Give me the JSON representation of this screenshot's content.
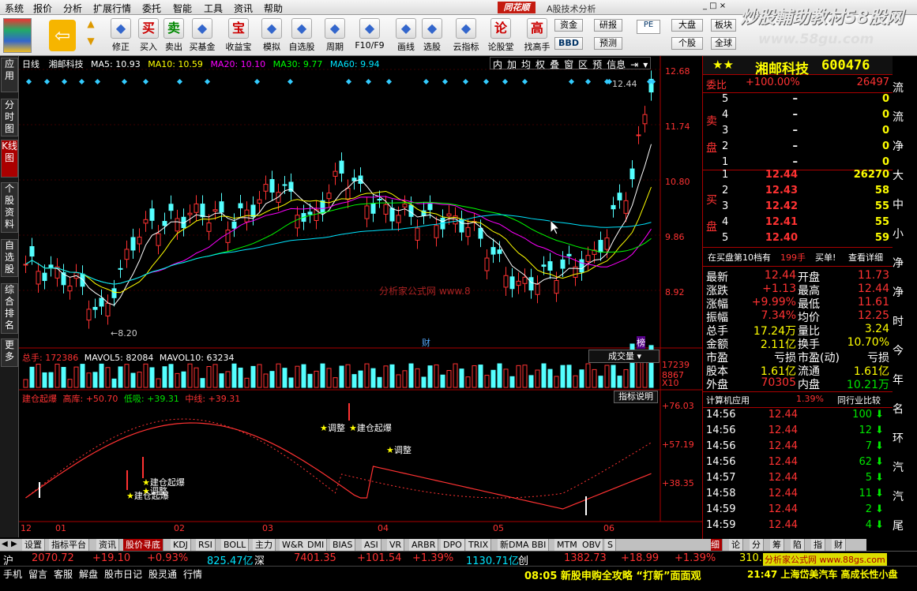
{
  "menu": [
    "系统",
    "报价",
    "分析",
    "扩展行情",
    "委托",
    "智能",
    "工具",
    "资讯",
    "帮助"
  ],
  "brand": "同花顺",
  "app_title": "A股技术分析",
  "watermark": {
    "title": "炒股輔助教材58股网",
    "url": "www.58gu.com"
  },
  "toolbar": {
    "buttons": [
      {
        "label": "修正",
        "icon": "refresh-icon"
      },
      {
        "label": "买入",
        "icon": "buy-icon",
        "glyph": "买"
      },
      {
        "label": "卖出",
        "icon": "sell-icon",
        "glyph": "卖"
      },
      {
        "label": "买基金",
        "icon": "fund-icon"
      },
      {
        "label": "收益宝",
        "icon": "bao-icon",
        "glyph": "宝"
      },
      {
        "label": "模拟",
        "icon": "hammer-icon"
      },
      {
        "label": "自选股",
        "icon": "star-icon"
      },
      {
        "label": "周期",
        "icon": "clock-icon"
      },
      {
        "label": "F10/F9",
        "icon": "f10-icon"
      },
      {
        "label": "画线",
        "icon": "pen-icon"
      },
      {
        "label": "选股",
        "icon": "picture-icon"
      },
      {
        "label": "云指标",
        "icon": "cloud-icon"
      },
      {
        "label": "论股堂",
        "icon": "lun-icon",
        "glyph": "论"
      },
      {
        "label": "找高手",
        "icon": "gao-icon",
        "glyph": "高"
      }
    ],
    "small": [
      "资金",
      "研报",
      "大盘",
      "板块",
      "BBD",
      "预测",
      "个股",
      "全球"
    ]
  },
  "sidebar": [
    "应用",
    "分时图",
    "K线图",
    "个股资料",
    "自选股",
    "综合排名",
    "更多"
  ],
  "chart": {
    "period": "日线",
    "name": "湘邮科技",
    "ma": [
      {
        "label": "MA5: 10.93",
        "color": "#ffffff"
      },
      {
        "label": "MA10: 10.59",
        "color": "#ffff00"
      },
      {
        "label": "MA20: 10.10",
        "color": "#ff00ff"
      },
      {
        "label": "MA30: 9.77",
        "color": "#00ff00"
      },
      {
        "label": "MA60: 9.94",
        "color": "#00e5ff"
      }
    ],
    "tools": [
      "内",
      "加",
      "均",
      "权",
      "叠",
      "窗",
      "区",
      "预",
      "信息"
    ],
    "price_axis": [
      "12.68",
      "11.74",
      "10.80",
      "9.86",
      "8.92"
    ],
    "high_label": "12.44",
    "low_label": "8.20",
    "marks": [
      "财",
      "榜"
    ],
    "vol_line": {
      "total": "总手: 172386",
      "mavol5": "MAVOL5: 82084",
      "mavol10": "MAVOL10: 63234"
    },
    "vol_axis": [
      "17239",
      "8867",
      "X10"
    ],
    "vol_btn": "成交量",
    "ind_line": {
      "name": "建仓起爆",
      "a": "高库: +50.70",
      "b": "低吸: +39.31",
      "c": "中线: +39.31"
    },
    "ind_btn": "指标说明",
    "ind_axis": [
      "+76.03",
      "+57.19",
      "+38.35"
    ],
    "annotations": [
      "建仓起爆",
      "调整",
      "建仓起爆",
      "调整",
      "建仓起爆",
      "调整"
    ],
    "center_watermark": "分析家公式网 www.8",
    "x_axis": [
      "12",
      "01",
      "02",
      "03",
      "04",
      "05",
      "06"
    ]
  },
  "quote": {
    "name": "湘邮科技",
    "code": "600476",
    "weibi": {
      "label": "委比",
      "value": "+100.00%",
      "diff": "26497"
    },
    "sell_label": "卖盘",
    "buy_label": "买盘",
    "sells": [
      {
        "n": "5",
        "p": "–",
        "v": "0"
      },
      {
        "n": "4",
        "p": "–",
        "v": "0"
      },
      {
        "n": "3",
        "p": "–",
        "v": "0"
      },
      {
        "n": "2",
        "p": "–",
        "v": "0"
      },
      {
        "n": "1",
        "p": "–",
        "v": "0"
      }
    ],
    "buys": [
      {
        "n": "1",
        "p": "12.44",
        "v": "26270"
      },
      {
        "n": "2",
        "p": "12.43",
        "v": "58"
      },
      {
        "n": "3",
        "p": "12.42",
        "v": "55"
      },
      {
        "n": "4",
        "p": "12.41",
        "v": "55"
      },
      {
        "n": "5",
        "p": "12.40",
        "v": "59"
      }
    ],
    "queue": {
      "text": "在买盘第10档有",
      "num": "199手",
      "action": "买单!",
      "detail": "查看详细"
    },
    "stats": [
      [
        "最新",
        "12.44",
        "开盘",
        "11.73"
      ],
      [
        "涨跌",
        "+1.13",
        "最高",
        "12.44"
      ],
      [
        "涨幅",
        "+9.99%",
        "最低",
        "11.61"
      ],
      [
        "振幅",
        "7.34%",
        "均价",
        "12.25"
      ],
      [
        "总手",
        "17.24万",
        "量比",
        "3.24"
      ],
      [
        "金额",
        "2.11亿",
        "换手",
        "10.70%"
      ],
      [
        "市盈",
        "亏损",
        "市盈(动)",
        "亏损"
      ],
      [
        "股本",
        "1.61亿",
        "流通",
        "1.61亿"
      ],
      [
        "外盘",
        "70305",
        "内盘",
        "10.21万"
      ]
    ],
    "calc": {
      "label": "计算机应用",
      "pct": "1.39%",
      "compare": "同行业比较"
    },
    "ticks": [
      {
        "t": "14:56",
        "p": "12.44",
        "v": "100"
      },
      {
        "t": "14:56",
        "p": "12.44",
        "v": "12"
      },
      {
        "t": "14:56",
        "p": "12.44",
        "v": "7"
      },
      {
        "t": "14:56",
        "p": "12.44",
        "v": "62"
      },
      {
        "t": "14:57",
        "p": "12.44",
        "v": "5"
      },
      {
        "t": "14:58",
        "p": "12.44",
        "v": "11"
      },
      {
        "t": "14:59",
        "p": "12.44",
        "v": "2"
      },
      {
        "t": "14:59",
        "p": "12.44",
        "v": "4"
      }
    ],
    "edge": [
      "流",
      "流",
      "净",
      "大",
      "中",
      "小",
      "净",
      "净",
      "时",
      "今",
      "年",
      "名",
      "环",
      "汽",
      "汽",
      "尾"
    ],
    "bottom_tabs": [
      "细",
      "论",
      "分",
      "筹",
      "陷",
      "指",
      "财"
    ]
  },
  "bottom_tabs": [
    "设置",
    "指标平台",
    "资讯",
    "股价寻底",
    "KDJ",
    "RSI",
    "BOLL",
    "主力",
    "W&R",
    "DMI",
    "BIAS",
    "ASI",
    "VR",
    "ARBR",
    "DPO",
    "TRIX",
    "新DMA",
    "BBI",
    "MTM",
    "OBV",
    "S"
  ],
  "status": {
    "sh": {
      "label": "沪",
      "v1": "2070.72",
      "v2": "+19.10",
      "v3": "+0.93%",
      "amt": "825.47亿"
    },
    "sz": {
      "label": "深",
      "v1": "7401.35",
      "v2": "+101.54",
      "v3": "+1.39%",
      "amt": "1130.71亿"
    },
    "cy": {
      "label": "创",
      "v1": "1382.73",
      "v2": "+18.99",
      "v3": "+1.39%"
    },
    "right_val": "310.5",
    "right_wm": "分析家公式网 www.88gs.com",
    "links": [
      "手机",
      "留言",
      "客服",
      "解盘",
      "股市日记",
      "股灵通",
      "行情"
    ],
    "news1": "08:05 新股申购全攻略 “打新”面面观",
    "news2": "21:47 上海岱美汽车 高成长性小盘"
  }
}
